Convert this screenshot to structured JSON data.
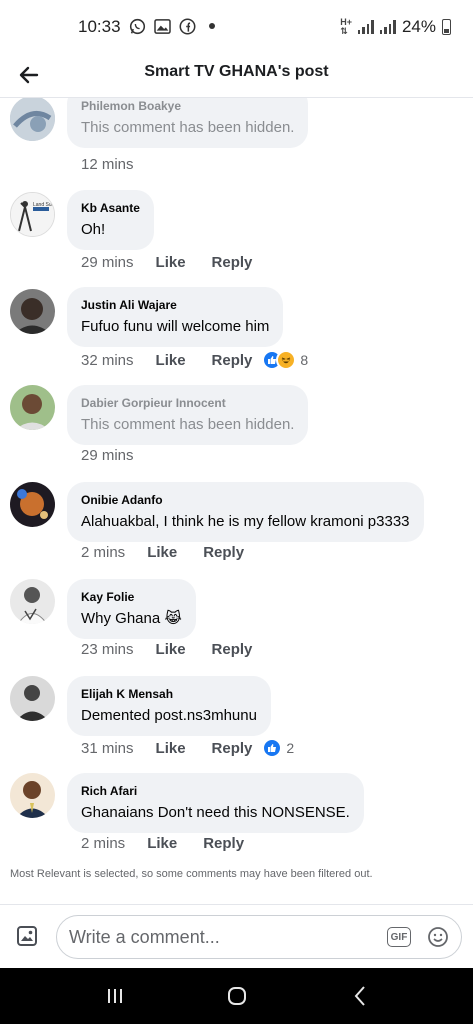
{
  "status_bar": {
    "time": "10:33",
    "battery": "24%",
    "icons": [
      "whatsapp-icon",
      "gallery-icon",
      "facebook-icon",
      "dot-icon",
      "data-icon",
      "signal-icon",
      "signal-icon",
      "battery-icon"
    ]
  },
  "header": {
    "title": "Smart TV GHANA's post",
    "back_icon": "back-arrow-icon"
  },
  "comments": [
    {
      "author": "Philemon Boakye",
      "text": "This comment has been hidden.",
      "time": "12 mins",
      "hidden": true
    },
    {
      "author": "Kb Asante",
      "text": "Oh!",
      "time": "29 mins",
      "like": "Like",
      "reply": "Reply"
    },
    {
      "author": "Justin Ali Wajare",
      "text": "Fufuo funu will welcome him",
      "time": "32 mins",
      "like": "Like",
      "reply": "Reply",
      "reaction_count": "8"
    },
    {
      "author": "Dabier Gorpieur Innocent",
      "text": "This comment has been hidden.",
      "time": "29 mins",
      "hidden": true
    },
    {
      "author": "Onibie Adanfo",
      "text": "Alahuakbal, I think he is my fellow kramoni p3333",
      "time": "2 mins",
      "like": "Like",
      "reply": "Reply"
    },
    {
      "author": "Kay Folie",
      "text": "Why Ghana 😹",
      "time": "23 mins",
      "like": "Like",
      "reply": "Reply"
    },
    {
      "author": "Elijah K Mensah",
      "text": "Demented post.ns3mhunu",
      "time": "31 mins",
      "like": "Like",
      "reply": "Reply",
      "reaction_count": "2"
    },
    {
      "author": "Rich Afari",
      "text": "Ghanaians Don't need this NONSENSE.",
      "time": "2 mins",
      "like": "Like",
      "reply": "Reply"
    }
  ],
  "footer_note": "Most Relevant is selected, so some comments may have been filtered out.",
  "composer": {
    "placeholder": "Write a comment...",
    "gif_label": "GIF"
  },
  "colors": {
    "bubble": "#f0f2f5",
    "like_blue": "#1877f2",
    "haha_yellow": "#f7b125",
    "muted_text": "#8a8d91"
  }
}
